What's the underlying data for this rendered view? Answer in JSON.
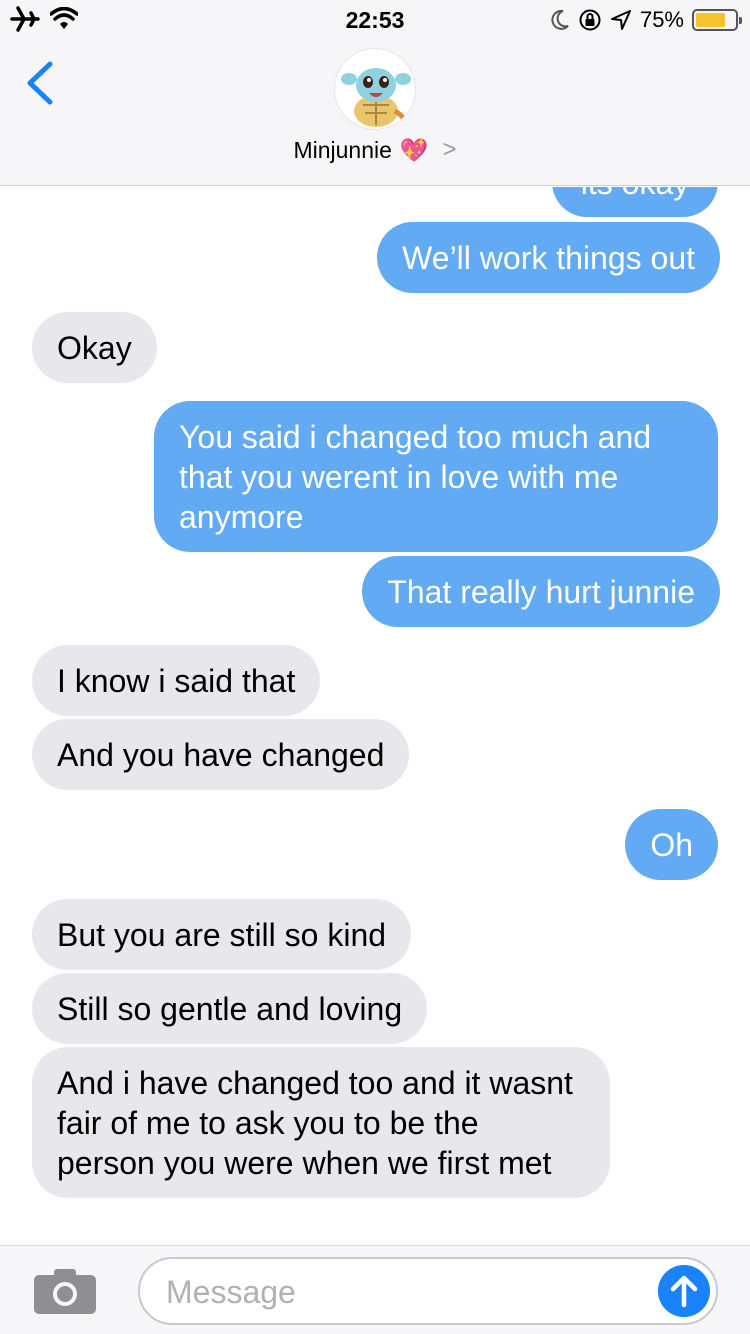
{
  "status_bar": {
    "time": "22:53",
    "battery_text": "75%",
    "battery_level": 0.75,
    "icons": [
      "airplane-icon",
      "wifi-icon",
      "moon-icon",
      "rotation-lock-icon",
      "location-icon",
      "battery-icon"
    ]
  },
  "header": {
    "contact_name": "Minjunnie",
    "contact_emoji": "💖",
    "chevron": ">"
  },
  "messages": [
    {
      "from": "me",
      "text": "its okay"
    },
    {
      "from": "me",
      "text": "We’ll work things out"
    },
    {
      "from": "them",
      "text": "Okay"
    },
    {
      "from": "me",
      "text": "You said i changed too much and that you werent in love with me anymore"
    },
    {
      "from": "me",
      "text": "That really hurt junnie"
    },
    {
      "from": "them",
      "text": "I know i said that"
    },
    {
      "from": "them",
      "text": "And you have changed"
    },
    {
      "from": "me",
      "text": "Oh"
    },
    {
      "from": "them",
      "text": "But you are still so kind"
    },
    {
      "from": "them",
      "text": "Still so gentle and loving"
    },
    {
      "from": "them",
      "text": "And i have changed too and it wasnt fair of me to ask you to be the person you were when we first met"
    }
  ],
  "composer": {
    "placeholder": "Message",
    "value": ""
  },
  "colors": {
    "sent_bubble": "#63aaf5",
    "received_bubble": "#e7e7ec",
    "accent": "#1a82fb",
    "battery": "#f5c42b"
  }
}
